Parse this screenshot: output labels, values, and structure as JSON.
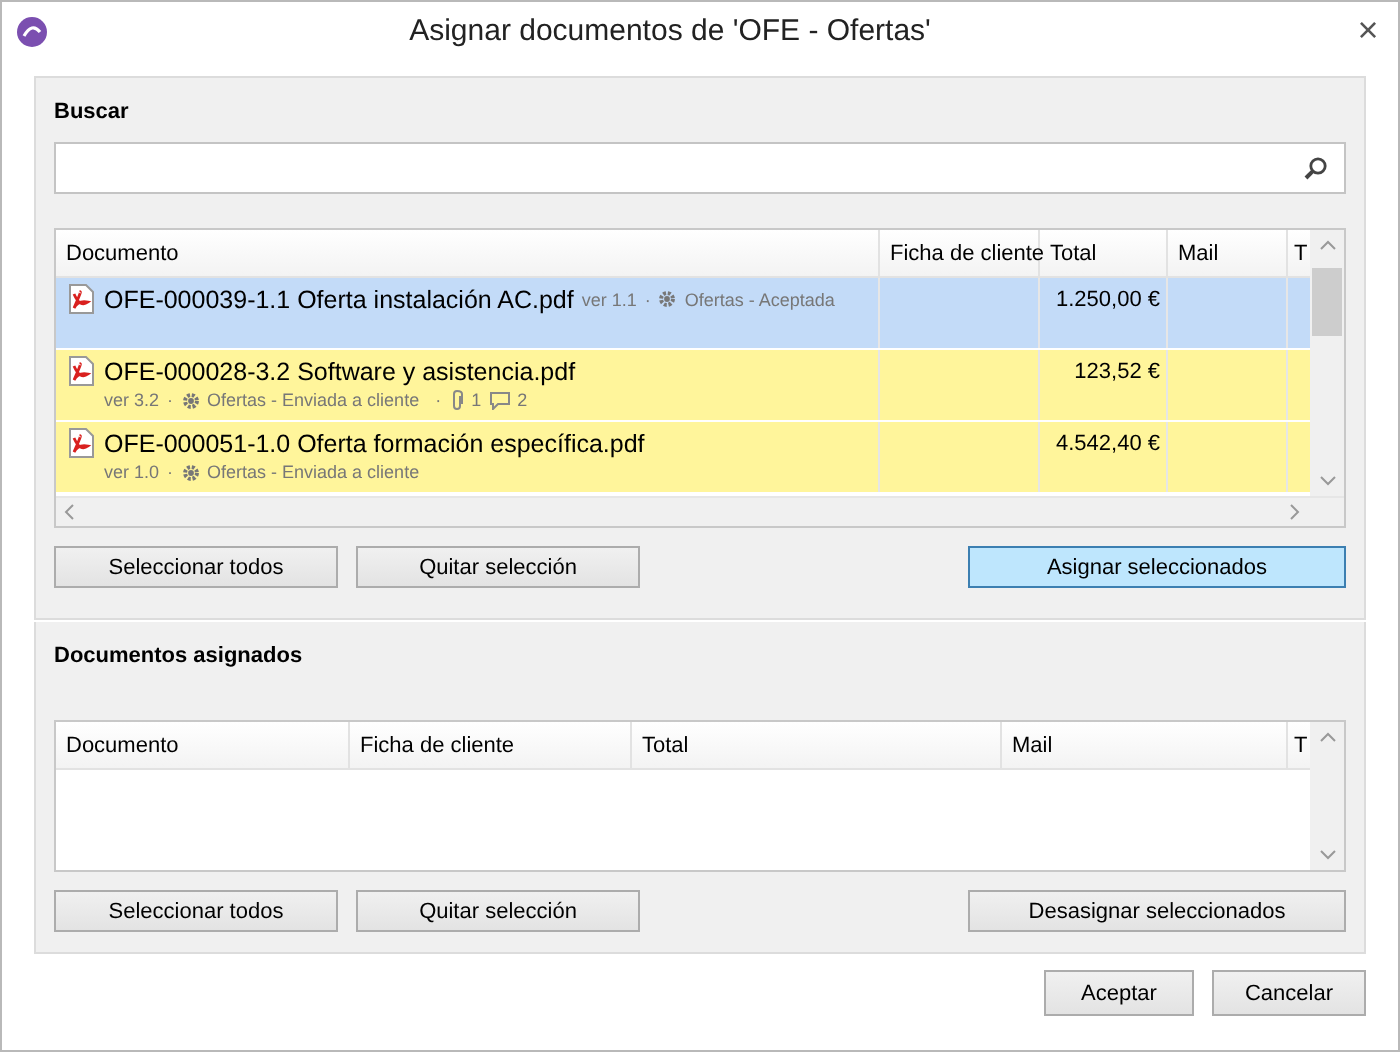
{
  "window": {
    "title": "Asignar documentos de 'OFE - Ofertas'",
    "close": "×"
  },
  "search": {
    "label": "Buscar"
  },
  "documents": {
    "columns": [
      "Documento",
      "Ficha de cliente",
      "Total",
      "Mail",
      "T"
    ],
    "rows": [
      {
        "kind": "inline",
        "name": "OFE-000039-1.1 Oferta instalación AC.pdf",
        "version": "ver 1.1",
        "category": "Ofertas - Aceptada",
        "separator": "·",
        "total": "1.250,00 €",
        "selected": true
      },
      {
        "kind": "two-line",
        "name": "OFE-000028-3.2 Software y asistencia.pdf",
        "version": "ver 3.2",
        "category": "Ofertas - Enviada a cliente",
        "separator": "·",
        "attachments": "1",
        "comments": "2",
        "total": "123,52 €",
        "selected": false,
        "color": "#fff59b"
      },
      {
        "kind": "two-line",
        "name": "OFE-000051-1.0 Oferta formación específica.pdf",
        "version": "ver 1.0",
        "category": "Ofertas - Enviada a cliente",
        "separator": "·",
        "total": "4.542,40 €",
        "selected": false,
        "color": "#fff59b"
      }
    ],
    "buttons": [
      "Seleccionar todos",
      "Quitar selección",
      "Asignar seleccionados"
    ]
  },
  "assigned": {
    "title": "Documentos asignados",
    "columns": [
      "Documento",
      "Ficha de cliente",
      "Total",
      "Mail",
      "T"
    ],
    "buttons": [
      "Seleccionar todos",
      "Quitar selección",
      "Desasignar seleccionados"
    ]
  },
  "footer_buttons": [
    "Aceptar",
    "Cancelar"
  ]
}
